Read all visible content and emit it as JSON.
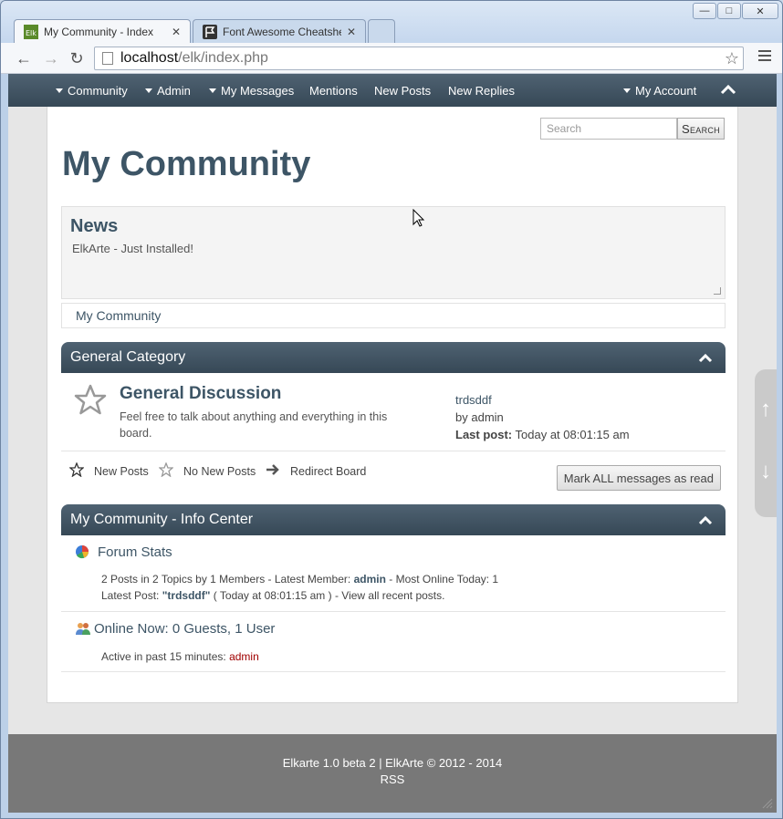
{
  "browser": {
    "tabs": [
      {
        "title": "My Community - Index",
        "active": true
      },
      {
        "title": "Font Awesome Cheatshee",
        "active": false
      }
    ],
    "url": {
      "host": "localhost",
      "path": "/elk/index.php"
    }
  },
  "menu": {
    "items": [
      "Community",
      "Admin",
      "My Messages",
      "Mentions",
      "New Posts",
      "New Replies"
    ],
    "account": "My Account"
  },
  "search": {
    "placeholder": "Search",
    "button": "Search"
  },
  "site_title": "My Community",
  "news": {
    "title": "News",
    "text": "ElkArte - Just Installed!"
  },
  "breadcrumb": "My Community",
  "category": {
    "title": "General Category",
    "board": {
      "name": "General Discussion",
      "description": "Feel free to talk about anything and everything in this board.",
      "last_topic": "trdsddf",
      "by_label": "by",
      "by_user": "admin",
      "last_post_label": "Last post:",
      "last_post_time": "Today at 08:01:15 am"
    }
  },
  "legend": {
    "new_posts": "New Posts",
    "no_new_posts": "No New Posts",
    "redirect": "Redirect Board",
    "mark_read": "Mark ALL messages as read"
  },
  "info_center": {
    "title": "My Community - Info Center",
    "stats_title": "Forum Stats",
    "stats_line1_prefix": "2 Posts in 2 Topics by 1 Members - Latest Member:",
    "stats_latest_member": "admin",
    "stats_line1_suffix": "- Most Online Today: 1",
    "stats_line2_prefix": "Latest Post:",
    "stats_latest_post": "\"trdsddf\"",
    "stats_line2_suffix": "( Today at 08:01:15 am ) - View all recent posts.",
    "online_title": "Online Now: 0 Guests, 1 User",
    "online_line_prefix": "Active in past 15 minutes:",
    "online_user": "admin"
  },
  "footer": {
    "line1": "Elkarte 1.0 beta 2 | ElkArte © 2012 - 2014",
    "line2": "RSS"
  },
  "colors": {
    "header": "#3d5566",
    "link_admin": "#a00000",
    "footer": "#787878"
  }
}
